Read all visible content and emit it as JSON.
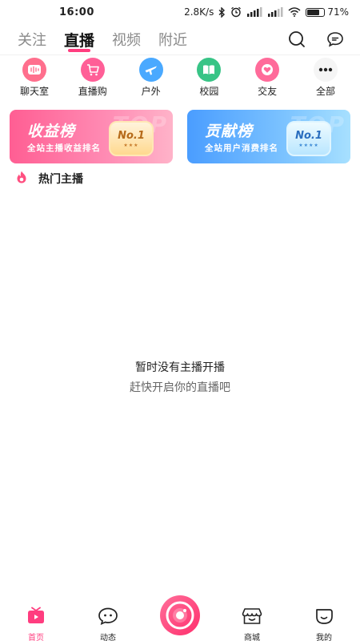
{
  "status": {
    "time": "16:00",
    "net_speed": "2.8K/s",
    "battery": "71%",
    "battery_level": 0.71
  },
  "top_tabs": [
    {
      "label": "关注",
      "active": false
    },
    {
      "label": "直播",
      "active": true
    },
    {
      "label": "视频",
      "active": false
    },
    {
      "label": "附近",
      "active": false
    }
  ],
  "categories": [
    {
      "label": "聊天室",
      "icon": "voice-wave-icon",
      "color": "#ff5f7e"
    },
    {
      "label": "直播购",
      "icon": "shopping-cart-icon",
      "color": "#ff4f8b"
    },
    {
      "label": "户外",
      "icon": "airplane-icon",
      "color": "#3aa6ff"
    },
    {
      "label": "校园",
      "icon": "book-icon",
      "color": "#2ec27e"
    },
    {
      "label": "交友",
      "icon": "heart-icon",
      "color": "#ff5a8a"
    },
    {
      "label": "全部",
      "icon": "more-dots-icon",
      "color": "#222222"
    }
  ],
  "cards": {
    "income": {
      "title": "收益榜",
      "subtitle": "全站主播收益排名",
      "bg_text": "TOP",
      "badge": "No.1",
      "stars": "★★★"
    },
    "contrib": {
      "title": "贡献榜",
      "subtitle": "全站用户消费排名",
      "bg_text": "TOP",
      "badge": "No.1",
      "stars": "★★★★"
    }
  },
  "section": {
    "title": "热门主播"
  },
  "empty": {
    "title": "暂时没有主播开播",
    "subtitle": "赶快开启你的直播吧"
  },
  "bottom_nav": [
    {
      "label": "首页",
      "icon": "home-live-icon",
      "active": true
    },
    {
      "label": "动态",
      "icon": "chat-face-icon",
      "active": false
    },
    {
      "label": "商城",
      "icon": "store-icon",
      "active": false
    },
    {
      "label": "我的",
      "icon": "profile-leaf-icon",
      "active": false
    }
  ],
  "colors": {
    "accent": "#ff3d7f",
    "income_card": "#ff5e93",
    "contrib_card": "#4a9dff"
  }
}
